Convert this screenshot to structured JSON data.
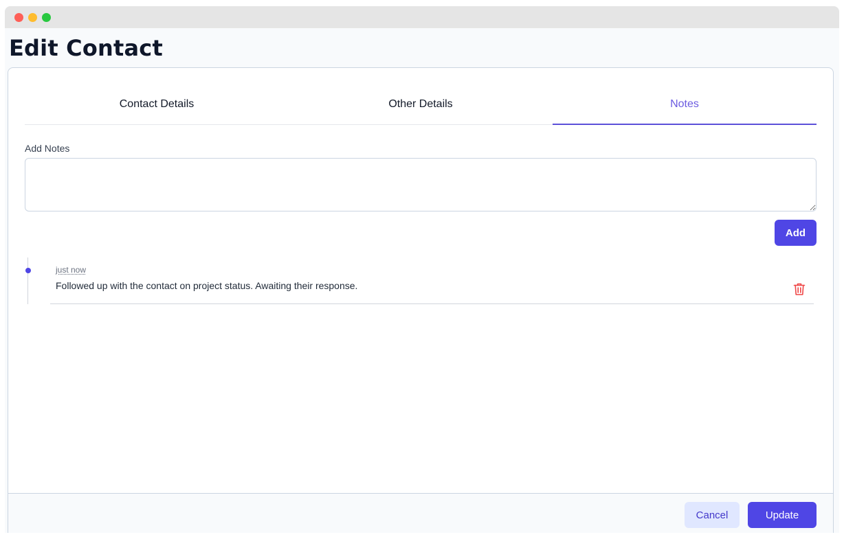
{
  "window": {
    "controls": [
      "close",
      "minimize",
      "maximize"
    ]
  },
  "page": {
    "title": "Edit Contact"
  },
  "tabs": [
    {
      "label": "Contact Details",
      "active": false
    },
    {
      "label": "Other Details",
      "active": false
    },
    {
      "label": "Notes",
      "active": true
    }
  ],
  "notes_form": {
    "label": "Add Notes",
    "value": "",
    "placeholder": "",
    "add_label": "Add"
  },
  "notes": [
    {
      "time": "just now",
      "text": "Followed up with the contact on project status. Awaiting their response.",
      "delete_icon": "trash-icon"
    }
  ],
  "footer": {
    "cancel_label": "Cancel",
    "update_label": "Update"
  },
  "colors": {
    "accent": "#4f46e5",
    "delete": "#ef4444",
    "cancel_bg": "#e0e7ff"
  }
}
